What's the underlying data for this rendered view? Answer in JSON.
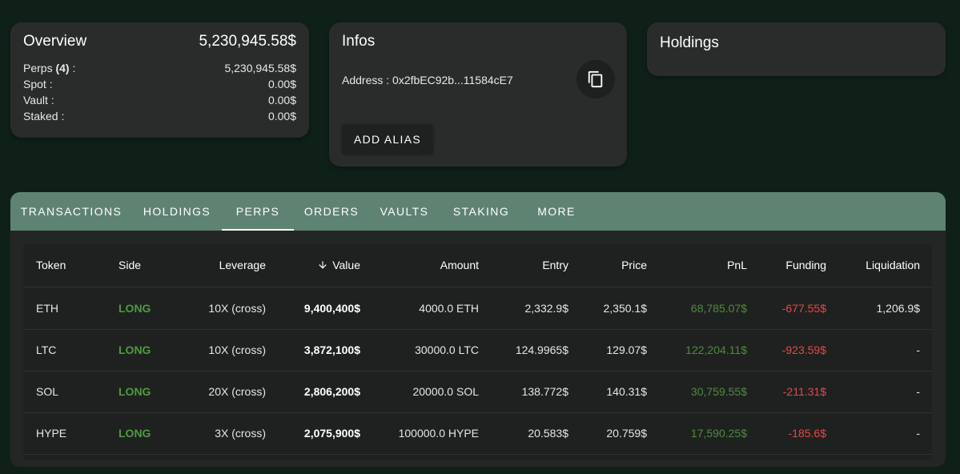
{
  "overview": {
    "title": "Overview",
    "total": "5,230,945.58$",
    "rows": [
      {
        "label": "Perps",
        "count": "(4)",
        "suffix": " :",
        "value": "5,230,945.58$"
      },
      {
        "label": "Spot :",
        "count": "",
        "suffix": "",
        "value": "0.00$"
      },
      {
        "label": "Vault :",
        "count": "",
        "suffix": "",
        "value": "0.00$"
      },
      {
        "label": "Staked :",
        "count": "",
        "suffix": "",
        "value": "0.00$"
      }
    ]
  },
  "infos": {
    "title": "Infos",
    "address": "Address : 0x2fbEC92b...11584cE7",
    "copy_icon": "copy-icon",
    "add_alias": "ADD ALIAS"
  },
  "holdings": {
    "title": "Holdings"
  },
  "tabs": [
    {
      "label": "TRANSACTIONS",
      "active": false
    },
    {
      "label": "HOLDINGS",
      "active": false
    },
    {
      "label": "PERPS",
      "active": true
    },
    {
      "label": "ORDERS",
      "active": false
    },
    {
      "label": "VAULTS",
      "active": false
    },
    {
      "label": "STAKING",
      "active": false
    },
    {
      "label": "MORE",
      "active": false
    }
  ],
  "table": {
    "columns": {
      "token": "Token",
      "side": "Side",
      "leverage": "Leverage",
      "value": "Value",
      "amount": "Amount",
      "entry": "Entry",
      "price": "Price",
      "pnl": "PnL",
      "funding": "Funding",
      "liquidation": "Liquidation"
    },
    "sort_icon": "arrow-down-icon",
    "rows": [
      {
        "token": "ETH",
        "side": "LONG",
        "leverage": "10X (cross)",
        "value": "9,400,400$",
        "amount": "4000.0 ETH",
        "entry": "2,332.9$",
        "price": "2,350.1$",
        "pnl": "68,785.07$",
        "funding": "-677.55$",
        "liquidation": "1,206.9$"
      },
      {
        "token": "LTC",
        "side": "LONG",
        "leverage": "10X (cross)",
        "value": "3,872,100$",
        "amount": "30000.0 LTC",
        "entry": "124.9965$",
        "price": "129.07$",
        "pnl": "122,204.11$",
        "funding": "-923.59$",
        "liquidation": "-"
      },
      {
        "token": "SOL",
        "side": "LONG",
        "leverage": "20X (cross)",
        "value": "2,806,200$",
        "amount": "20000.0 SOL",
        "entry": "138.772$",
        "price": "140.31$",
        "pnl": "30,759.55$",
        "funding": "-211.31$",
        "liquidation": "-"
      },
      {
        "token": "HYPE",
        "side": "LONG",
        "leverage": "3X (cross)",
        "value": "2,075,900$",
        "amount": "100000.0 HYPE",
        "entry": "20.583$",
        "price": "20.759$",
        "pnl": "17,590.25$",
        "funding": "-185.6$",
        "liquidation": "-"
      }
    ]
  },
  "colors": {
    "background": "#0f2019",
    "card": "#2a2c2b",
    "tab_bar": "#5f8373",
    "long": "#4e9a41",
    "pnl_positive": "#4f8a3f",
    "funding_negative": "#e04a4a"
  }
}
